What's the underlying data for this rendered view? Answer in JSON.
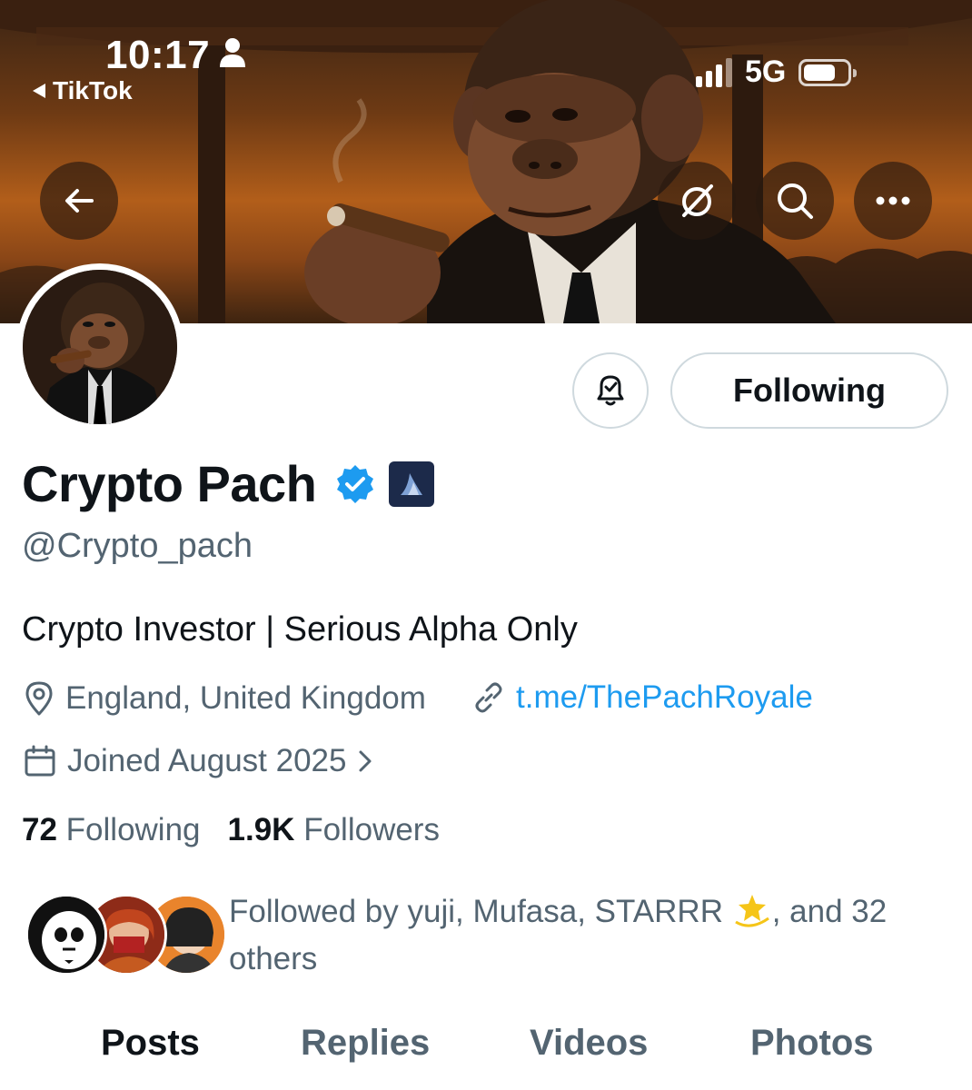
{
  "status_bar": {
    "time": "10:17",
    "back_app": "TikTok",
    "network": "5G"
  },
  "header_buttons": {
    "back_icon": "arrow-left-icon",
    "grok_icon": "slash-circle-icon",
    "search_icon": "search-icon",
    "more_icon": "more-dots-icon"
  },
  "profile": {
    "display_name": "Crypto Pach",
    "handle": "@Crypto_pach",
    "bio": "Crypto Investor | Serious Alpha Only",
    "location": "England, United Kingdom",
    "link": "t.me/ThePachRoyale",
    "joined": "Joined August 2025",
    "following_count": "72",
    "following_label": "Following",
    "followers_count": "1.9K",
    "followers_label": "Followers",
    "followed_by_prefix": "Followed by yuji, Mufasa, STARRR ",
    "followed_by_suffix": ", and 32 others"
  },
  "actions": {
    "follow_button": "Following",
    "notify_icon": "bell-check-icon"
  },
  "tabs": [
    {
      "label": "Posts",
      "active": true
    },
    {
      "label": "Replies",
      "active": false
    },
    {
      "label": "Videos",
      "active": false
    },
    {
      "label": "Photos",
      "active": false
    }
  ],
  "colors": {
    "accent": "#1d9bf0",
    "secondary_text": "#536471",
    "primary_text": "#0f1419"
  }
}
